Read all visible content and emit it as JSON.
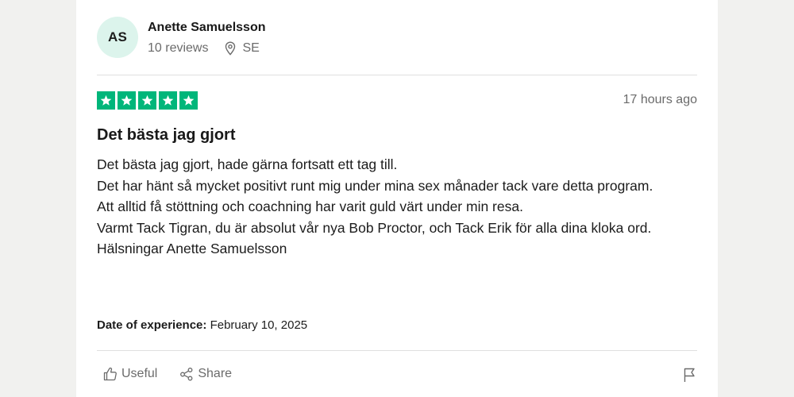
{
  "consumer": {
    "initials": "AS",
    "name": "Anette Samuelsson",
    "reviews": "10 reviews",
    "country": "SE"
  },
  "review": {
    "rating": 5,
    "rating_max": 5,
    "posted": "17 hours ago",
    "title": "Det bästa jag gjort",
    "body_lines": [
      "Det bästa jag gjort, hade gärna fortsatt ett tag till.",
      "Det har hänt så mycket positivt runt mig under mina sex månader tack vare detta program.",
      "Att alltid få stöttning och coachning har varit guld värt under min resa.",
      "Varmt Tack Tigran, du är absolut vår nya Bob Proctor, och Tack Erik för alla dina kloka ord.",
      "Hälsningar Anette Samuelsson"
    ],
    "experience_label": "Date of experience:",
    "experience_date": "February 10, 2025"
  },
  "actions": {
    "useful_label": "Useful",
    "share_label": "Share"
  },
  "icons": {
    "location": "location-pin-icon",
    "star": "star-icon",
    "useful": "thumbs-up-icon",
    "share": "share-icon",
    "report": "flag-icon"
  },
  "colors": {
    "star_green": "#00b67a",
    "avatar_bg": "#dcf4ec",
    "muted_text": "#6b6b6b",
    "divider": "#e0e0e0"
  }
}
